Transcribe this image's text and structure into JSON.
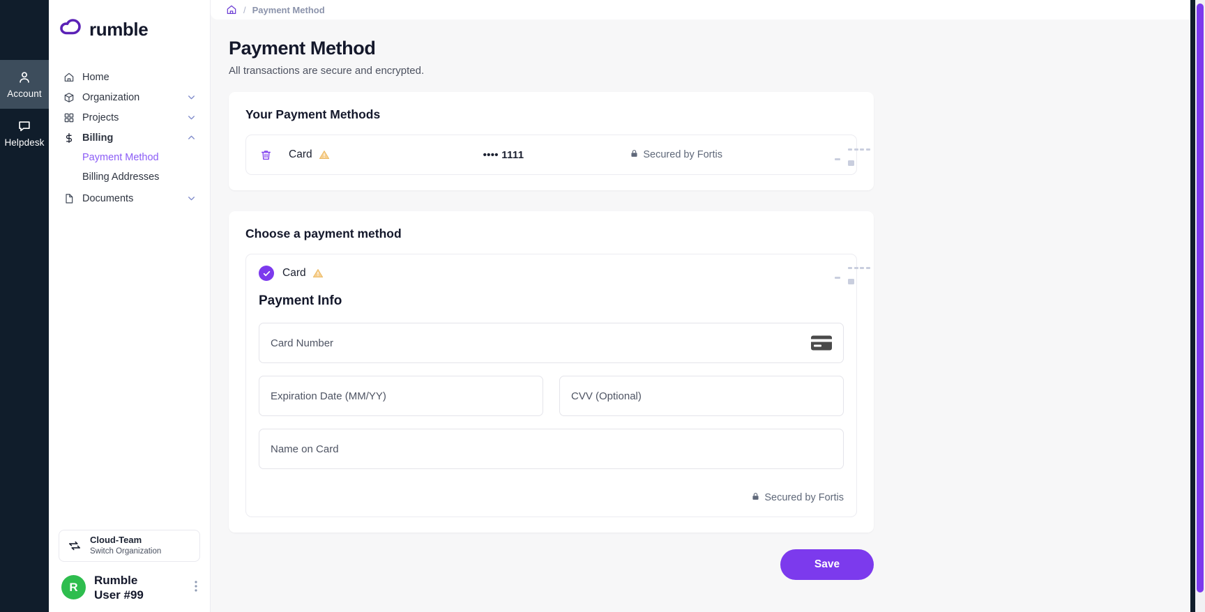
{
  "rail": {
    "items": [
      {
        "label": "Account",
        "icon": "user-icon",
        "active": true
      },
      {
        "label": "Helpdesk",
        "icon": "chat-icon",
        "active": false
      }
    ]
  },
  "sidebar": {
    "brand": "rumble",
    "nav": [
      {
        "label": "Home",
        "icon": "home-icon",
        "chevron": "",
        "bold": false
      },
      {
        "label": "Organization",
        "icon": "cube-icon",
        "chevron": "chevron-down-icon",
        "bold": false
      },
      {
        "label": "Projects",
        "icon": "grid-icon",
        "chevron": "chevron-down-icon",
        "bold": false
      },
      {
        "label": "Billing",
        "icon": "dollar-icon",
        "chevron": "chevron-up-icon",
        "bold": true
      }
    ],
    "subnav": [
      {
        "label": "Payment Method",
        "active": true
      },
      {
        "label": "Billing Addresses",
        "active": false
      }
    ],
    "documents": {
      "label": "Documents",
      "icon": "document-icon",
      "chevron": "chevron-down-icon"
    },
    "switch_org": {
      "name": "Cloud-Team",
      "subtitle": "Switch Organization",
      "icon": "switch-icon"
    },
    "user": {
      "avatar_letter": "R",
      "name_line1": "Rumble",
      "name_line2": "User #99",
      "menu_icon": "kebab-menu-icon"
    }
  },
  "breadcrumb": {
    "home_icon": "home-icon",
    "separator": "/",
    "current": "Payment Method"
  },
  "page": {
    "title": "Payment Method",
    "subtitle": "All transactions are secure and encrypted."
  },
  "your_methods": {
    "heading": "Your Payment Methods",
    "rows": [
      {
        "delete_icon": "trash-icon",
        "label": "Card",
        "warning_icon": "warning-triangle-icon",
        "masked_number": "•••• 1111",
        "secured_text": "Secured by Fortis",
        "lock_icon": "lock-icon",
        "card_art": "credit-card-icon"
      }
    ]
  },
  "choose_method": {
    "heading": "Choose a payment method",
    "selected": {
      "label": "Card",
      "warning_icon": "warning-triangle-icon",
      "radio_icon": "check-circle-icon",
      "card_art": "credit-card-icon"
    },
    "payment_info_heading": "Payment Info",
    "fields": {
      "card_number": {
        "placeholder": "Card Number",
        "value": "",
        "icon": "credit-card-icon"
      },
      "expiration": {
        "placeholder": "Expiration Date (MM/YY)",
        "value": ""
      },
      "cvv": {
        "placeholder": "CVV (Optional)",
        "value": ""
      },
      "name_on_card": {
        "placeholder": "Name on Card",
        "value": ""
      }
    },
    "secured_text": "Secured by Fortis",
    "lock_icon": "lock-icon"
  },
  "footer": {
    "save_label": "Save"
  },
  "colors": {
    "accent_purple": "#7c3aed",
    "rail_dark": "#101d2b",
    "rail_active": "#3d4d5c",
    "avatar_green": "#2ebd4e",
    "card_art_navy": "#2b3a5c",
    "warning_amber": "#f5c97a",
    "link_purple": "#8b5cf6"
  }
}
